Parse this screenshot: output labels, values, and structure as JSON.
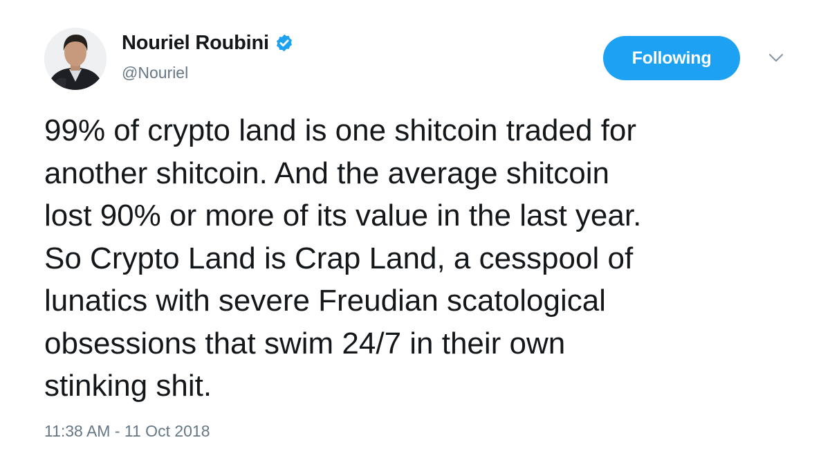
{
  "user": {
    "display_name": "Nouriel Roubini",
    "handle": "@Nouriel",
    "verified_icon": "verified-badge-icon",
    "avatar": "profile-photo"
  },
  "actions": {
    "follow_label": "Following",
    "more_icon": "chevron-down-icon"
  },
  "tweet": {
    "lines": [
      "99% of crypto land is one shitcoin traded for",
      "another shitcoin. And the average shitcoin",
      "lost 90% or more of its value in the last year.",
      "So Crypto Land is Crap Land, a cesspool of",
      "lunatics with severe Freudian scatological",
      "obsessions that swim 24/7 in their own",
      "stinking shit."
    ],
    "timestamp": "11:38 AM - 11 Oct 2018"
  },
  "colors": {
    "accent": "#1da1f2",
    "text": "#14171a",
    "secondary_text": "#657786"
  }
}
